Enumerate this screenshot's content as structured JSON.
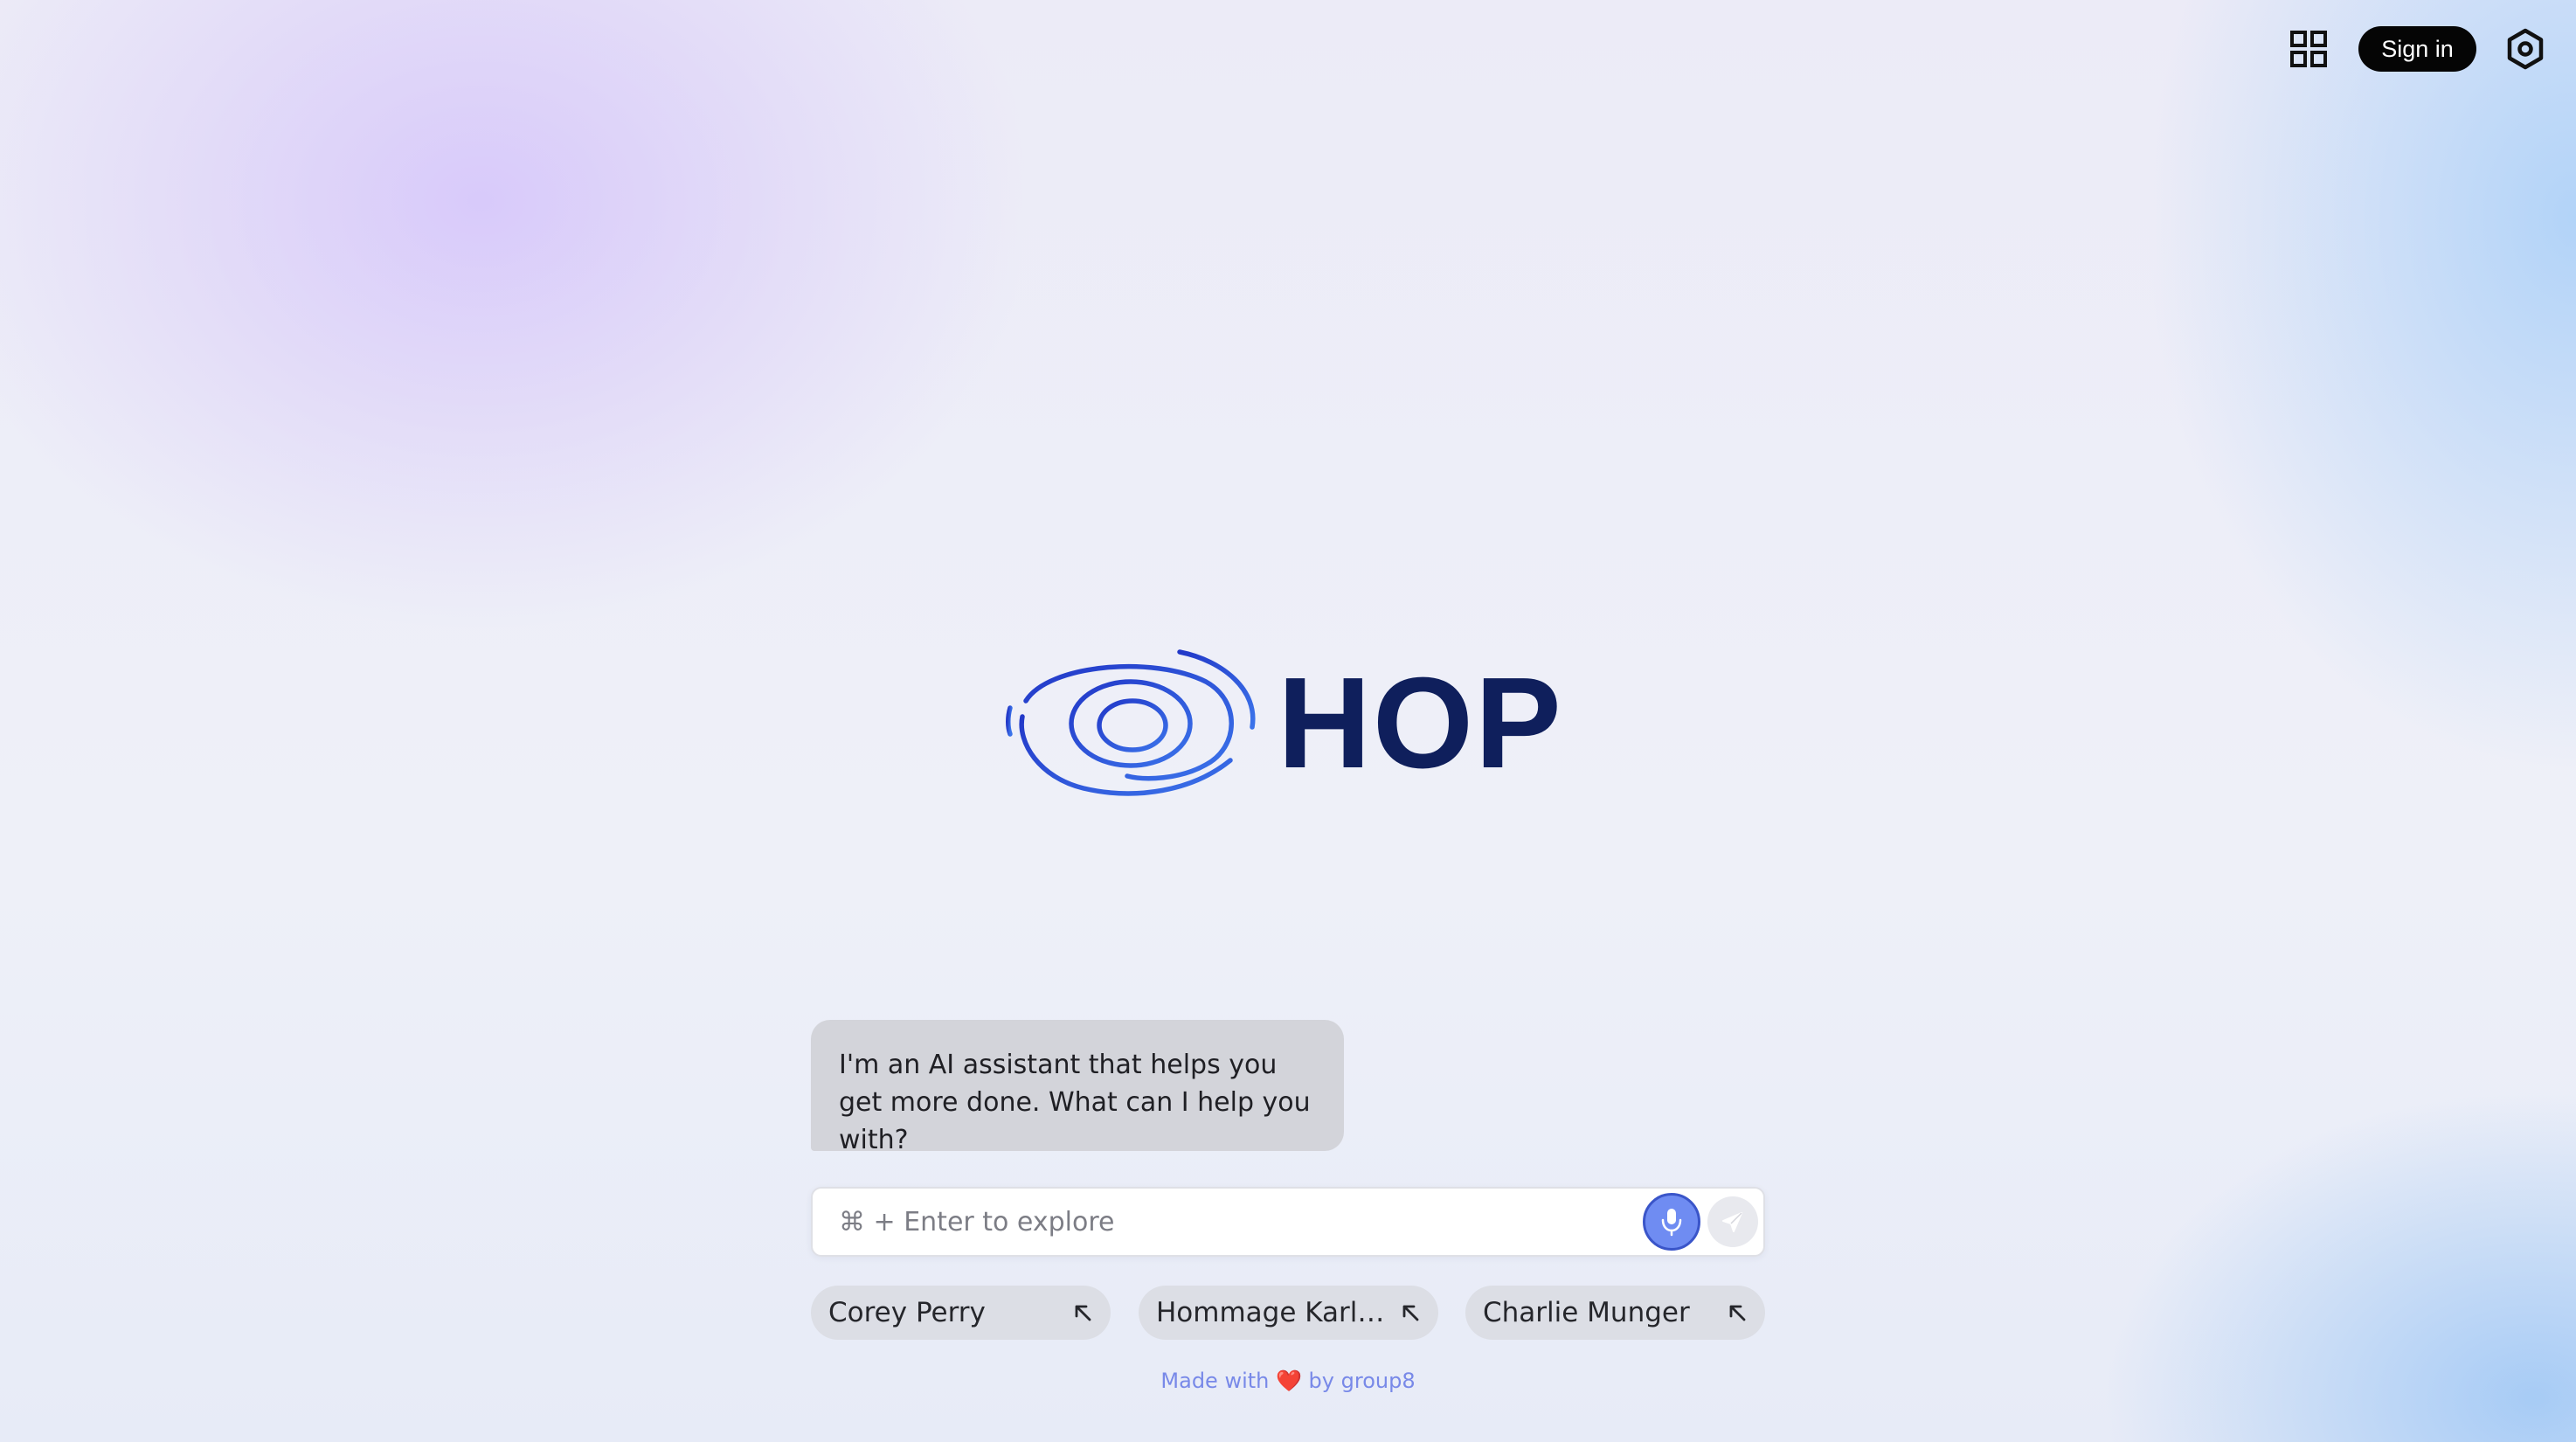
{
  "header": {
    "apps_icon": "grid-icon",
    "sign_in_label": "Sign in",
    "settings_icon": "hexagon-settings-icon"
  },
  "brand": {
    "logo_icon": "spiral-logo-icon",
    "name": "HOP",
    "text_color": "#0f1f5c",
    "mark_color": "#2f55e0"
  },
  "assistant": {
    "message": "I'm an AI assistant that helps you get more done. What can I help you with?"
  },
  "composer": {
    "value": "",
    "placeholder": "⌘ + Enter to explore",
    "mic_icon": "microphone-icon",
    "send_icon": "send-icon",
    "mic_color": "#6f8cf2"
  },
  "suggestions": [
    {
      "label": "Corey Perry",
      "icon": "arrow-up-left-icon"
    },
    {
      "label": "Hommage Karl T...",
      "icon": "arrow-up-left-icon"
    },
    {
      "label": "Charlie Munger",
      "icon": "arrow-up-left-icon"
    }
  ],
  "footer": {
    "prefix": "Made with",
    "heart": "❤️",
    "suffix": "by group8",
    "color": "#7889e8"
  }
}
